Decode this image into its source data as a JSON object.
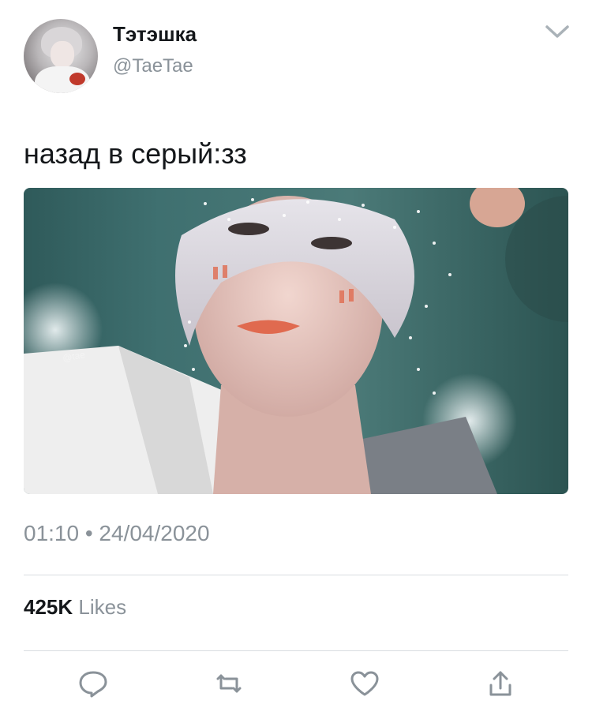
{
  "tweet": {
    "display_name": "Тэтэшка",
    "handle": "@TaeTae",
    "text": "назад в серый:зз",
    "timestamp": "01:10 • 24/04/2020",
    "likes_count": "425K",
    "likes_label": "Likes"
  },
  "icons": {
    "menu": "chevron-down-icon",
    "reply": "reply-icon",
    "retweet": "retweet-icon",
    "like": "heart-icon",
    "share": "share-icon"
  },
  "colors": {
    "text_primary": "#14171a",
    "text_secondary": "#8a9299",
    "icon": "#8a9299",
    "divider": "#d8dde1"
  }
}
